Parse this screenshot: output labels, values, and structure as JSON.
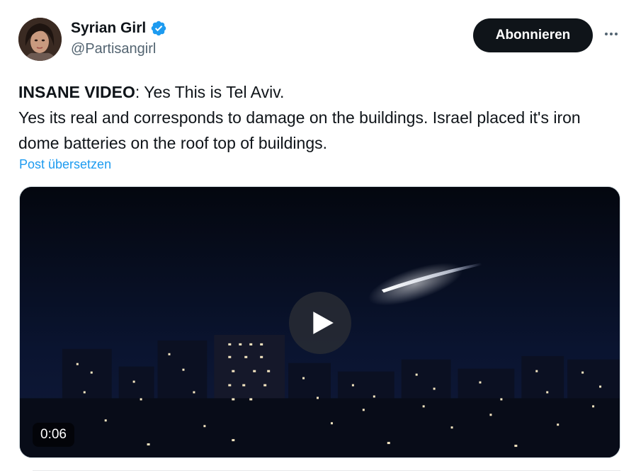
{
  "author": {
    "name": "Syrian Girl",
    "handle": "@Partisangirl",
    "verified": true,
    "avatar_icon": "profile-photo"
  },
  "actions": {
    "follow_label": "Abonnieren",
    "more_icon": "ellipsis-icon"
  },
  "post": {
    "text_bold": "INSANE VIDEO",
    "text_line1_rest": ": Yes This is Tel Aviv.",
    "text_line2": "Yes its real and corresponds to damage on the buildings. Israel placed it's iron dome batteries on the roof top of buildings.",
    "translate_label": "Post übersetzen"
  },
  "media": {
    "type": "video",
    "duration": "0:06",
    "play_icon": "play-icon"
  },
  "colors": {
    "accent": "#1d9bf0",
    "button_bg": "#0f1419",
    "secondary_text": "#536471"
  }
}
